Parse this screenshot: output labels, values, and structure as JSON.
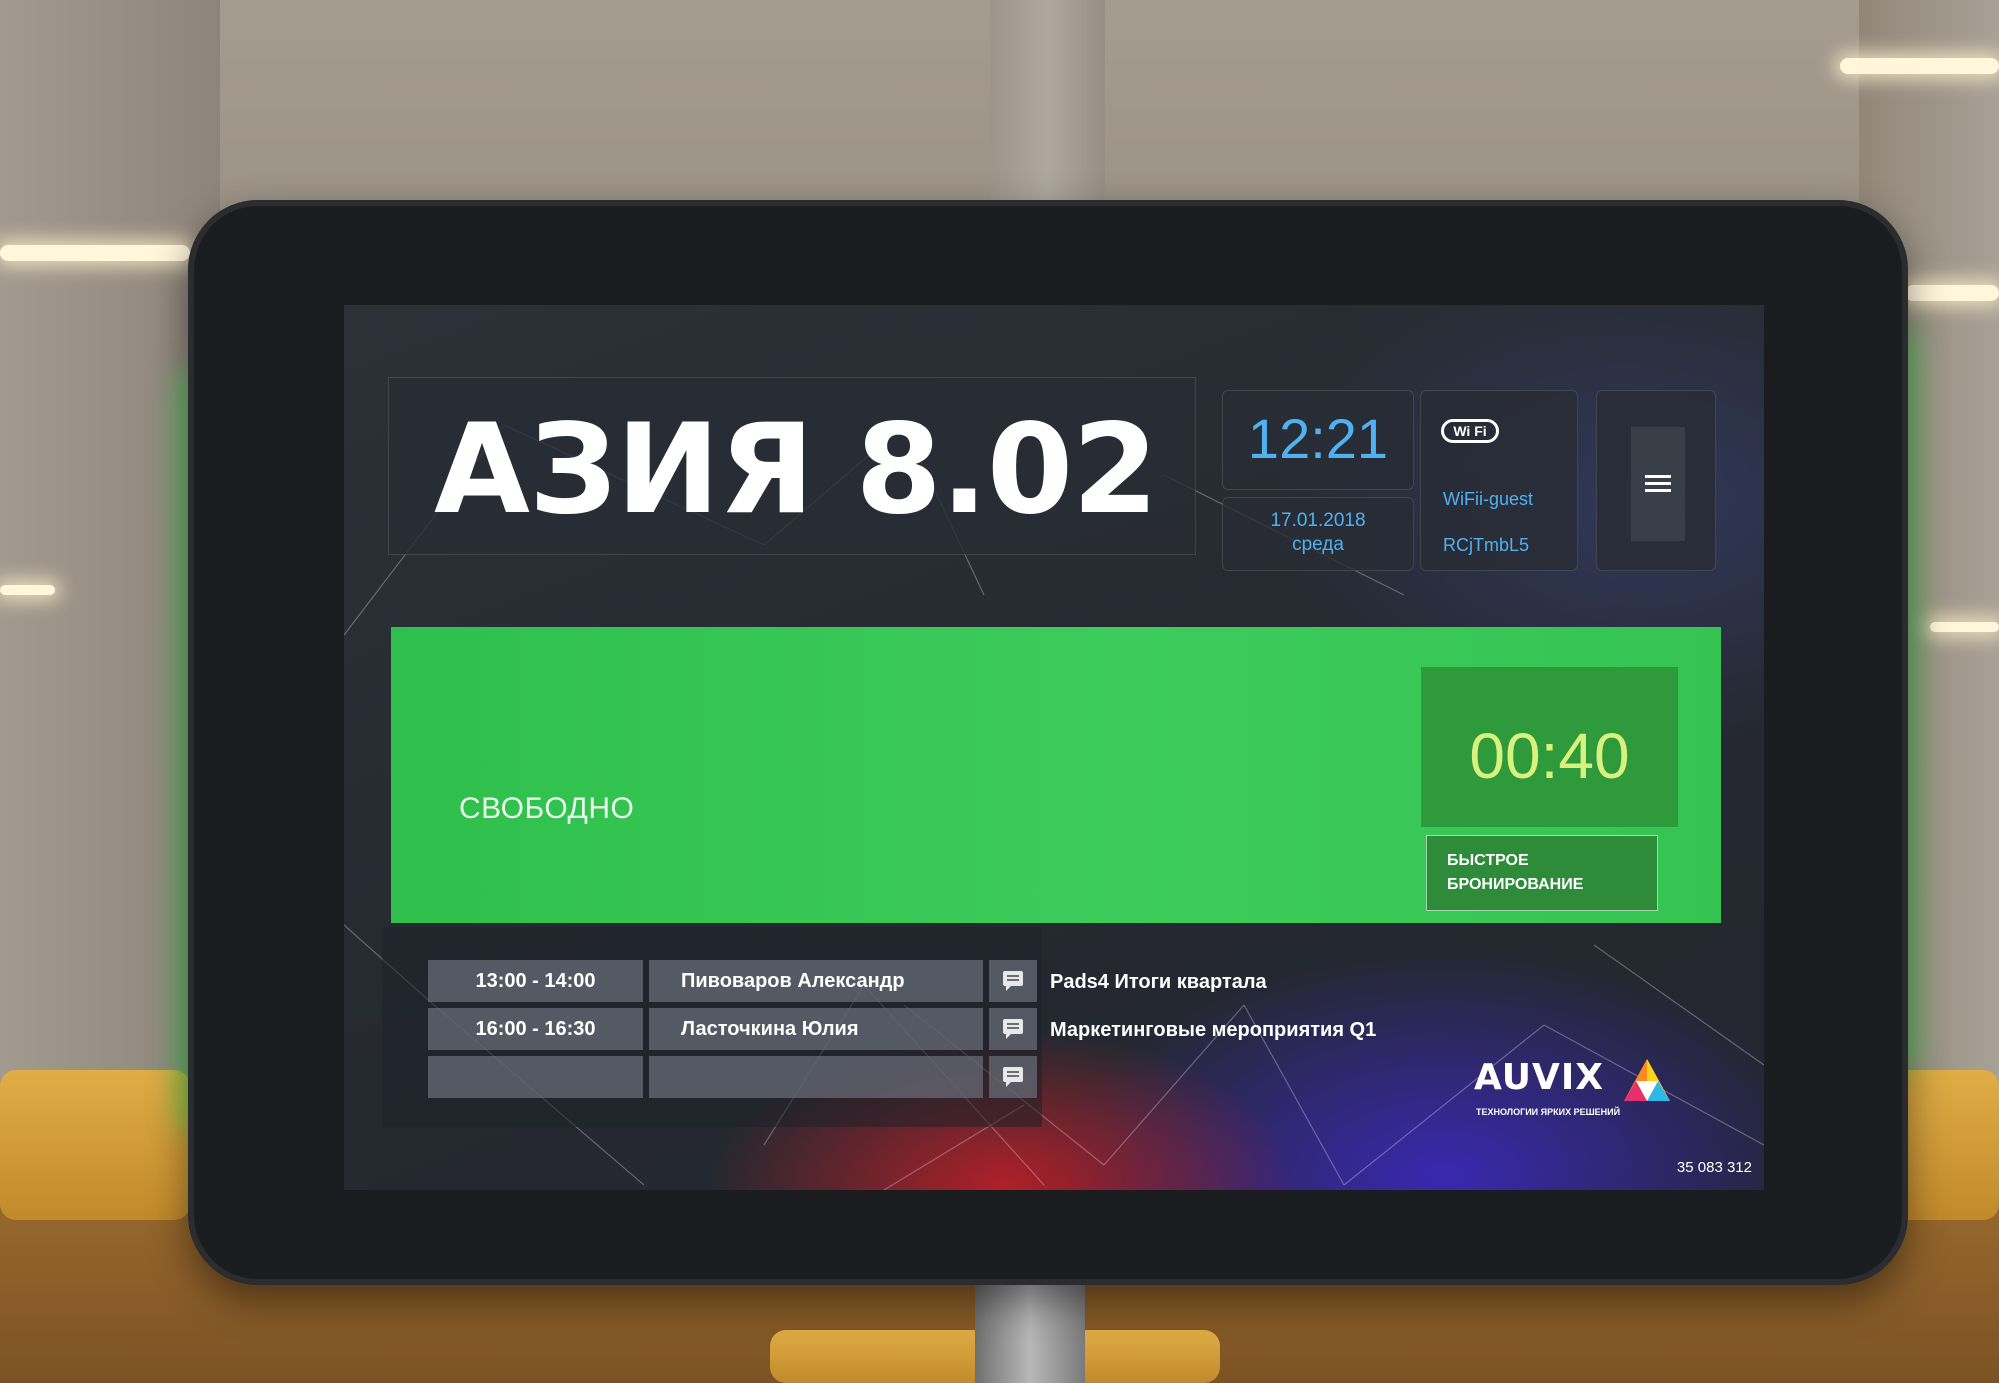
{
  "room": {
    "name": "АЗИЯ 8.02"
  },
  "clock": {
    "time": "12:21",
    "date": "17.01.2018",
    "weekday": "среда"
  },
  "wifi": {
    "logo_text": "Wi Fi",
    "network": "WiFii-guest",
    "password": "RCjTmbL5"
  },
  "status": {
    "label": "СВОБОДНО",
    "timer": "00:40",
    "color": "#3dcc5b",
    "quick_book_line1": "БЫСТРОЕ",
    "quick_book_line2": "БРОНИРОВАНИЕ"
  },
  "schedule": [
    {
      "time": "13:00 - 14:00",
      "organizer": "Пивоваров Александр",
      "topic": "Pads4 Итоги квартала"
    },
    {
      "time": "16:00 - 16:30",
      "organizer": "Ласточкина Юлия",
      "topic": "Маркетинговые мероприятия Q1"
    },
    {
      "time": "",
      "organizer": "",
      "topic": ""
    }
  ],
  "brand": {
    "name": "AUVIX",
    "tagline": "ТЕХНОЛОГИИ ЯРКИХ РЕШЕНИЙ"
  },
  "device_id": "35 083 312",
  "colors": {
    "accent_blue": "#4fb1f2",
    "timer_text": "#d9f27e",
    "status_led": "#37e84a"
  }
}
